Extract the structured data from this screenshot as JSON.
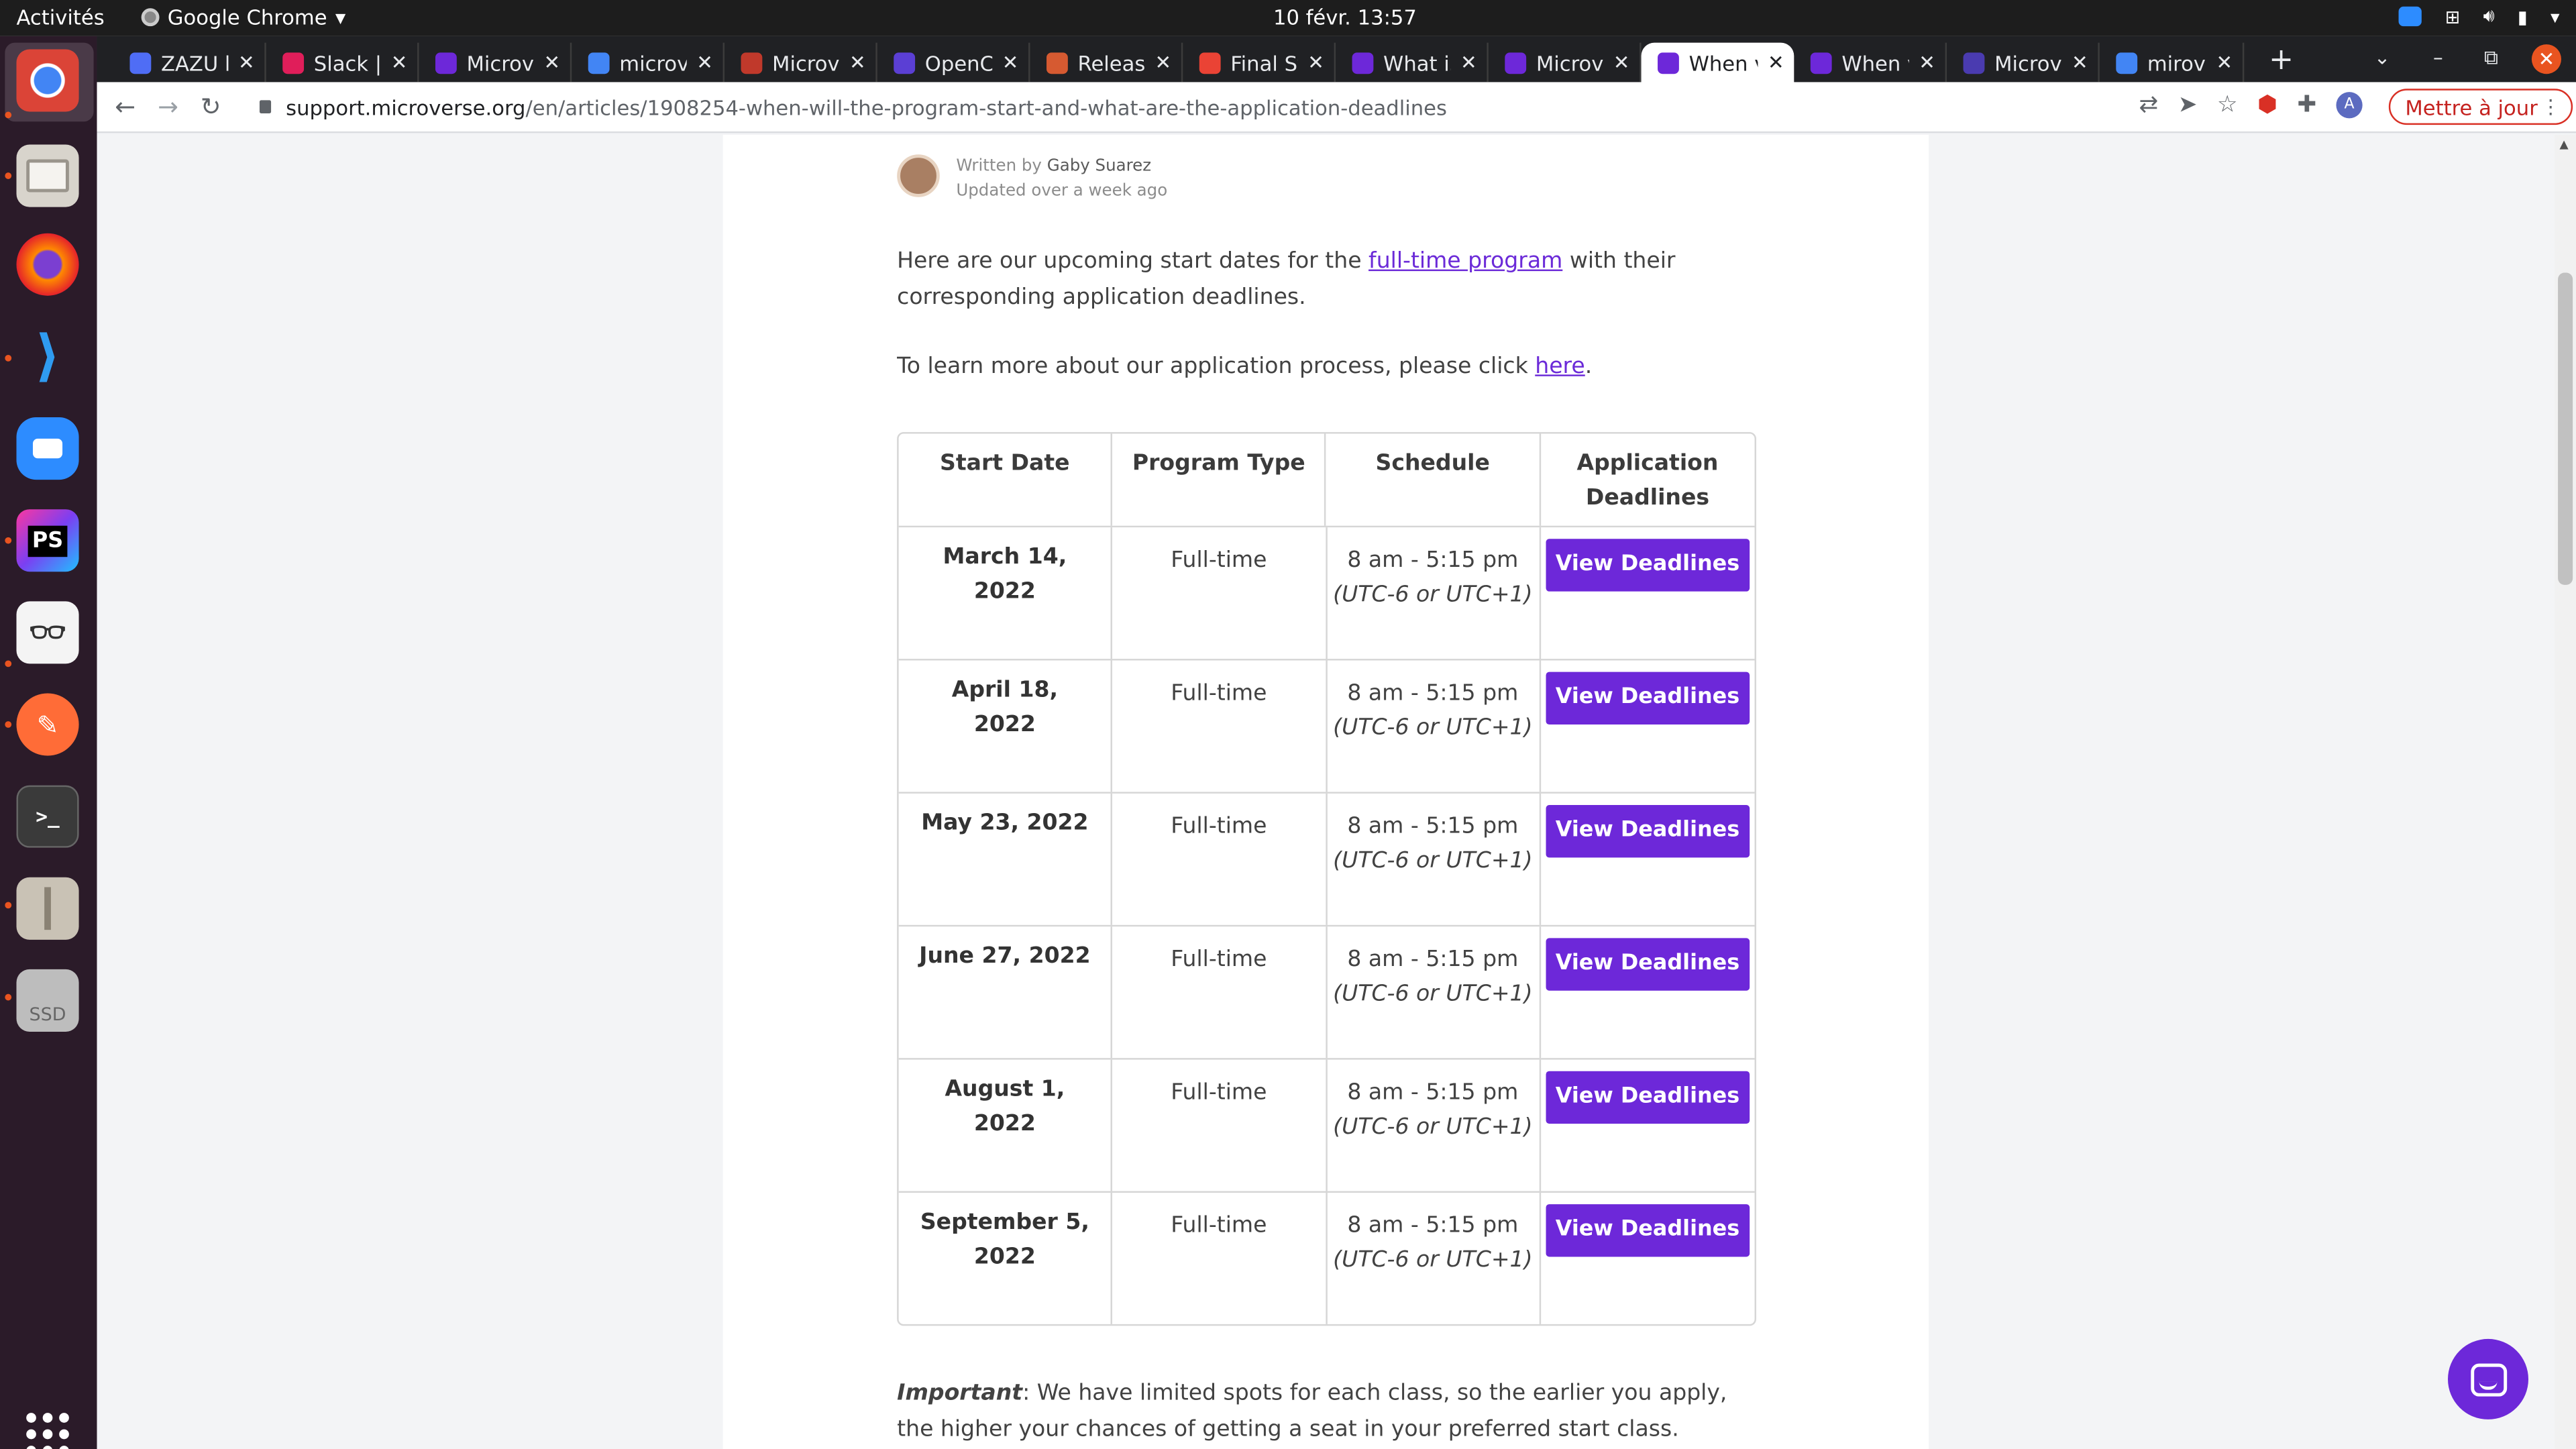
{
  "os": {
    "activities": "Activités",
    "app_menu": "Google Chrome",
    "clock": "10 févr.  13:57"
  },
  "browser": {
    "tabs": [
      {
        "label": "ZAZU b",
        "color": "#4f6df5"
      },
      {
        "label": "Slack | ",
        "color": "#e01e5a"
      },
      {
        "label": "Microv",
        "color": "#6d28d9"
      },
      {
        "label": "microv",
        "color": "#4285f4"
      },
      {
        "label": "Microv",
        "color": "#c0392b"
      },
      {
        "label": "OpenC",
        "color": "#5b3fd4"
      },
      {
        "label": "Release",
        "color": "#d65a31"
      },
      {
        "label": "Final St",
        "color": "#ea4335"
      },
      {
        "label": "What is",
        "color": "#6d28d9"
      },
      {
        "label": "Microv",
        "color": "#6d28d9"
      },
      {
        "label": "When v",
        "color": "#6d28d9"
      },
      {
        "label": "When v",
        "color": "#6d28d9"
      },
      {
        "label": "Microv",
        "color": "#4a3bb0"
      },
      {
        "label": "mirove",
        "color": "#4285f4"
      }
    ],
    "active_tab_index": 10,
    "url_host": "support.microverse.org",
    "url_path": "/en/articles/1908254-when-will-the-program-start-and-what-are-the-application-deadlines",
    "profile_initial": "A",
    "update_button": "Mettre à jour"
  },
  "article": {
    "written_by_prefix": "Written by",
    "author": "Gaby Suarez",
    "updated": "Updated over a week ago",
    "intro_before": "Here are our upcoming start dates for the ",
    "intro_link": "full-time program",
    "intro_after": " with their corresponding application deadlines.",
    "learn_before": "To learn more about our application process, please click ",
    "learn_link": "here",
    "learn_after": ".",
    "table": {
      "headers": [
        "Start Date",
        "Program Type",
        "Schedule",
        "Application Deadlines"
      ],
      "rows": [
        {
          "date": "March 14, 2022",
          "type": "Full-time",
          "time": "8 am - 5:15 pm",
          "tz": "(UTC-6 or UTC+1)",
          "button": "View Deadlines"
        },
        {
          "date": "April 18, 2022",
          "type": "Full-time",
          "time": "8 am - 5:15 pm",
          "tz": "(UTC-6 or UTC+1)",
          "button": "View Deadlines"
        },
        {
          "date": "May 23, 2022",
          "type": "Full-time",
          "time": "8 am - 5:15 pm",
          "tz": "(UTC-6 or UTC+1)",
          "button": "View Deadlines"
        },
        {
          "date": "June 27, 2022",
          "type": "Full-time",
          "time": "8 am - 5:15 pm",
          "tz": "(UTC-6 or UTC+1)",
          "button": "View Deadlines"
        },
        {
          "date": "August 1, 2022",
          "type": "Full-time",
          "time": "8 am - 5:15 pm",
          "tz": "(UTC-6 or UTC+1)",
          "button": "View Deadlines"
        },
        {
          "date": "September 5, 2022",
          "type": "Full-time",
          "time": "8 am - 5:15 pm",
          "tz": "(UTC-6 or UTC+1)",
          "button": "View Deadlines"
        }
      ]
    },
    "important_label": "Important",
    "important_text": ": We have limited spots for each class, so the earlier you apply, the higher your chances of getting a seat in your preferred start class."
  },
  "dock": {
    "icons": [
      "chrome-icon",
      "files-icon",
      "firefox-icon",
      "vscode-icon",
      "zoom-icon",
      "phpstorm-icon",
      "document-viewer-icon",
      "postman-icon",
      "terminal-icon",
      "archive-icon",
      "ssd-drive-icon"
    ],
    "ps_label": "PS",
    "ssd_label": "SSD"
  },
  "colors": {
    "accent": "#6d28d9",
    "link": "#6b2ad8"
  }
}
